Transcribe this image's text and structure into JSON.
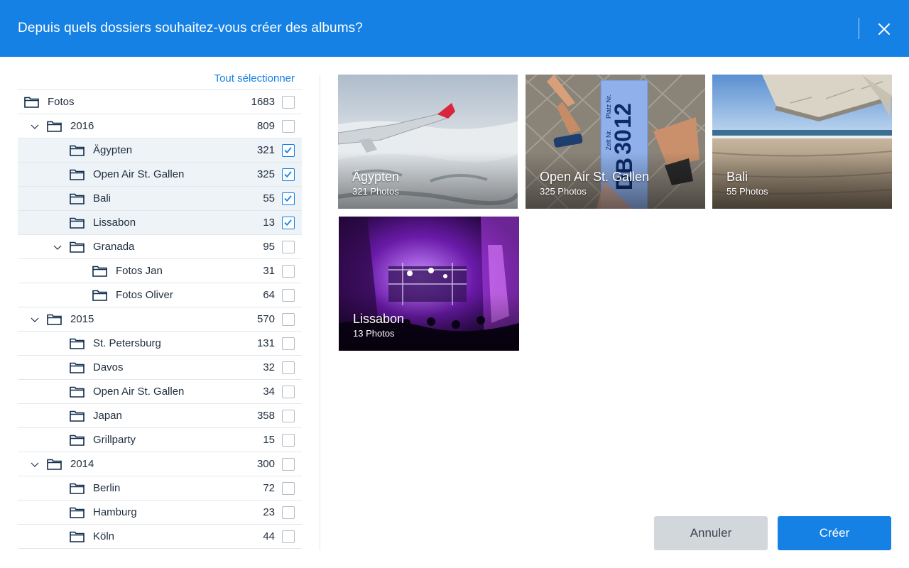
{
  "header": {
    "title": "Depuis quels dossiers souhaitez-vous créer des albums?"
  },
  "tree": {
    "select_all": "Tout sélectionner",
    "rows": [
      {
        "label": "Fotos",
        "count": "1683",
        "level": 0,
        "expandable": false,
        "checked": false
      },
      {
        "label": "2016",
        "count": "809",
        "level": 1,
        "expandable": true,
        "checked": false
      },
      {
        "label": "Ägypten",
        "count": "321",
        "level": 2,
        "expandable": false,
        "checked": true
      },
      {
        "label": "Open Air St. Gallen",
        "count": "325",
        "level": 2,
        "expandable": false,
        "checked": true
      },
      {
        "label": "Bali",
        "count": "55",
        "level": 2,
        "expandable": false,
        "checked": true
      },
      {
        "label": "Lissabon",
        "count": "13",
        "level": 2,
        "expandable": false,
        "checked": true
      },
      {
        "label": "Granada",
        "count": "95",
        "level": 2,
        "expandable": true,
        "checked": false
      },
      {
        "label": "Fotos Jan",
        "count": "31",
        "level": 3,
        "expandable": false,
        "checked": false
      },
      {
        "label": "Fotos Oliver",
        "count": "64",
        "level": 3,
        "expandable": false,
        "checked": false
      },
      {
        "label": "2015",
        "count": "570",
        "level": 1,
        "expandable": true,
        "checked": false
      },
      {
        "label": "St. Petersburg",
        "count": "131",
        "level": 2,
        "expandable": false,
        "checked": false
      },
      {
        "label": "Davos",
        "count": "32",
        "level": 2,
        "expandable": false,
        "checked": false
      },
      {
        "label": "Open Air St. Gallen",
        "count": "34",
        "level": 2,
        "expandable": false,
        "checked": false
      },
      {
        "label": "Japan",
        "count": "358",
        "level": 2,
        "expandable": false,
        "checked": false
      },
      {
        "label": "Grillparty",
        "count": "15",
        "level": 2,
        "expandable": false,
        "checked": false
      },
      {
        "label": "2014",
        "count": "300",
        "level": 1,
        "expandable": true,
        "checked": false
      },
      {
        "label": "Berlin",
        "count": "72",
        "level": 2,
        "expandable": false,
        "checked": false
      },
      {
        "label": "Hamburg",
        "count": "23",
        "level": 2,
        "expandable": false,
        "checked": false
      },
      {
        "label": "Köln",
        "count": "44",
        "level": 2,
        "expandable": false,
        "checked": false
      }
    ]
  },
  "albums": [
    {
      "title": "Ägypten",
      "subtitle": "321 Photos",
      "image": "airplane-wing-over-clouds"
    },
    {
      "title": "Open Air St. Gallen",
      "subtitle": "325 Photos",
      "image": "festival-ticket-and-feet"
    },
    {
      "title": "Bali",
      "subtitle": "55 Photos",
      "image": "beach-under-plane-wing"
    },
    {
      "title": "Lissabon",
      "subtitle": "13 Photos",
      "image": "concert-stage-purple-lights"
    }
  ],
  "ticket_text": {
    "a": "Platz Nr.",
    "b": "Zelt Nr.",
    "c": "12",
    "d": "30",
    "e": "DB"
  },
  "buttons": {
    "cancel": "Annuler",
    "create": "Créer"
  },
  "colors": {
    "accent": "#1581e4",
    "selected_row": "#edf3f7",
    "cancel_bg": "#d2d7dc"
  },
  "icons": {
    "folder": "folder-icon",
    "chevron": "chevron-down-icon",
    "close": "close-icon",
    "check": "check-icon"
  }
}
